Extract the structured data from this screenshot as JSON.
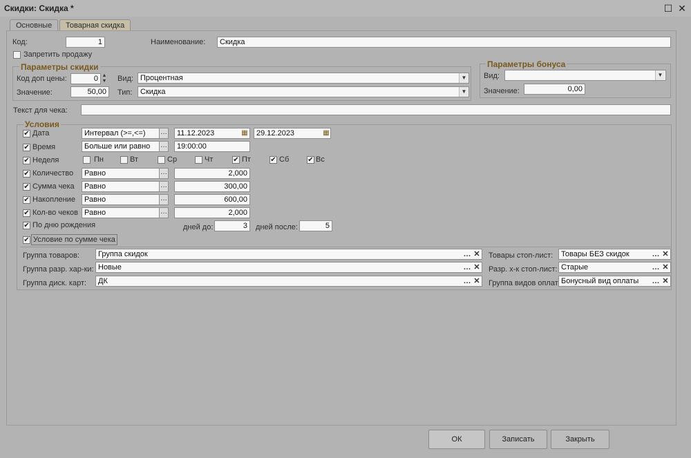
{
  "window": {
    "title": "Скидки: Скидка *"
  },
  "tabs": [
    {
      "label": "Основные"
    },
    {
      "label": "Товарная скидка"
    }
  ],
  "main": {
    "code_label": "Код:",
    "code_value": "1",
    "name_label": "Наименование:",
    "name_value": "Скидка",
    "forbid_sale_label": "Запретить продажу"
  },
  "discount_params": {
    "title": "Параметры скидки",
    "code_price_label": "Код доп цены:",
    "code_price_value": "0",
    "kind_label": "Вид:",
    "kind_value": "Процентная",
    "value_label": "Значение:",
    "value_value": "50,00",
    "type_label": "Тип:",
    "type_value": "Скидка"
  },
  "bonus_params": {
    "title": "Параметры бонуса",
    "kind_label": "Вид:",
    "kind_value": "",
    "value_label": "Значение:",
    "value_value": "0,00"
  },
  "receipt": {
    "label": "Текст для чека:",
    "value": ""
  },
  "conditions": {
    "title": "Условия",
    "date": {
      "label": "Дата",
      "mode": "Интервал (>=,<=)",
      "from": "11.12.2023",
      "to": "29.12.2023"
    },
    "time": {
      "label": "Время",
      "mode": "Больше или равно",
      "value": "19:00:00"
    },
    "week": {
      "label": "Неделя",
      "days": [
        {
          "label": "Пн",
          "checked": false
        },
        {
          "label": "Вт",
          "checked": false
        },
        {
          "label": "Ср",
          "checked": false
        },
        {
          "label": "Чт",
          "checked": false
        },
        {
          "label": "Пт",
          "checked": true
        },
        {
          "label": "Сб",
          "checked": true
        },
        {
          "label": "Вс",
          "checked": true
        }
      ]
    },
    "quantity": {
      "label": "Количество",
      "mode": "Равно",
      "value": "2,000"
    },
    "receipt_sum": {
      "label": "Сумма чека",
      "mode": "Равно",
      "value": "300,00"
    },
    "accumulation": {
      "label": "Накопление",
      "mode": "Равно",
      "value": "600,00"
    },
    "receipt_count": {
      "label": "Кол-во чеков",
      "mode": "Равно",
      "value": "2,000"
    },
    "birthday": {
      "label": "По дню рождения",
      "days_before_label": "дней до:",
      "days_before": "3",
      "days_after_label": "дней после:",
      "days_after": "5"
    },
    "sum_condition": {
      "label": "Условие по сумме чека"
    }
  },
  "groups": {
    "goods_label": "Группа товаров:",
    "goods_value": "Группа скидок",
    "chars_label": "Группа разр. хар-ки:",
    "chars_value": "Новые",
    "cards_label": "Группа диск. карт:",
    "cards_value": "ДК",
    "stop_goods_label": "Товары стоп-лист:",
    "stop_goods_value": "Товары БЕЗ скидок",
    "stop_chars_label": "Разр. х-к стоп-лист:",
    "stop_chars_value": "Старые",
    "payments_label": "Группа видов оплат:",
    "payments_value": "Бонусный вид оплаты"
  },
  "footer": {
    "ok": "ОК",
    "save": "Записать",
    "close": "Закрыть"
  },
  "icons": {
    "check": "check-icon",
    "dots": "ellipsis-icon",
    "clear": "clear-icon",
    "dropdown": "chevron-down-icon",
    "calendar": "calendar-icon"
  }
}
